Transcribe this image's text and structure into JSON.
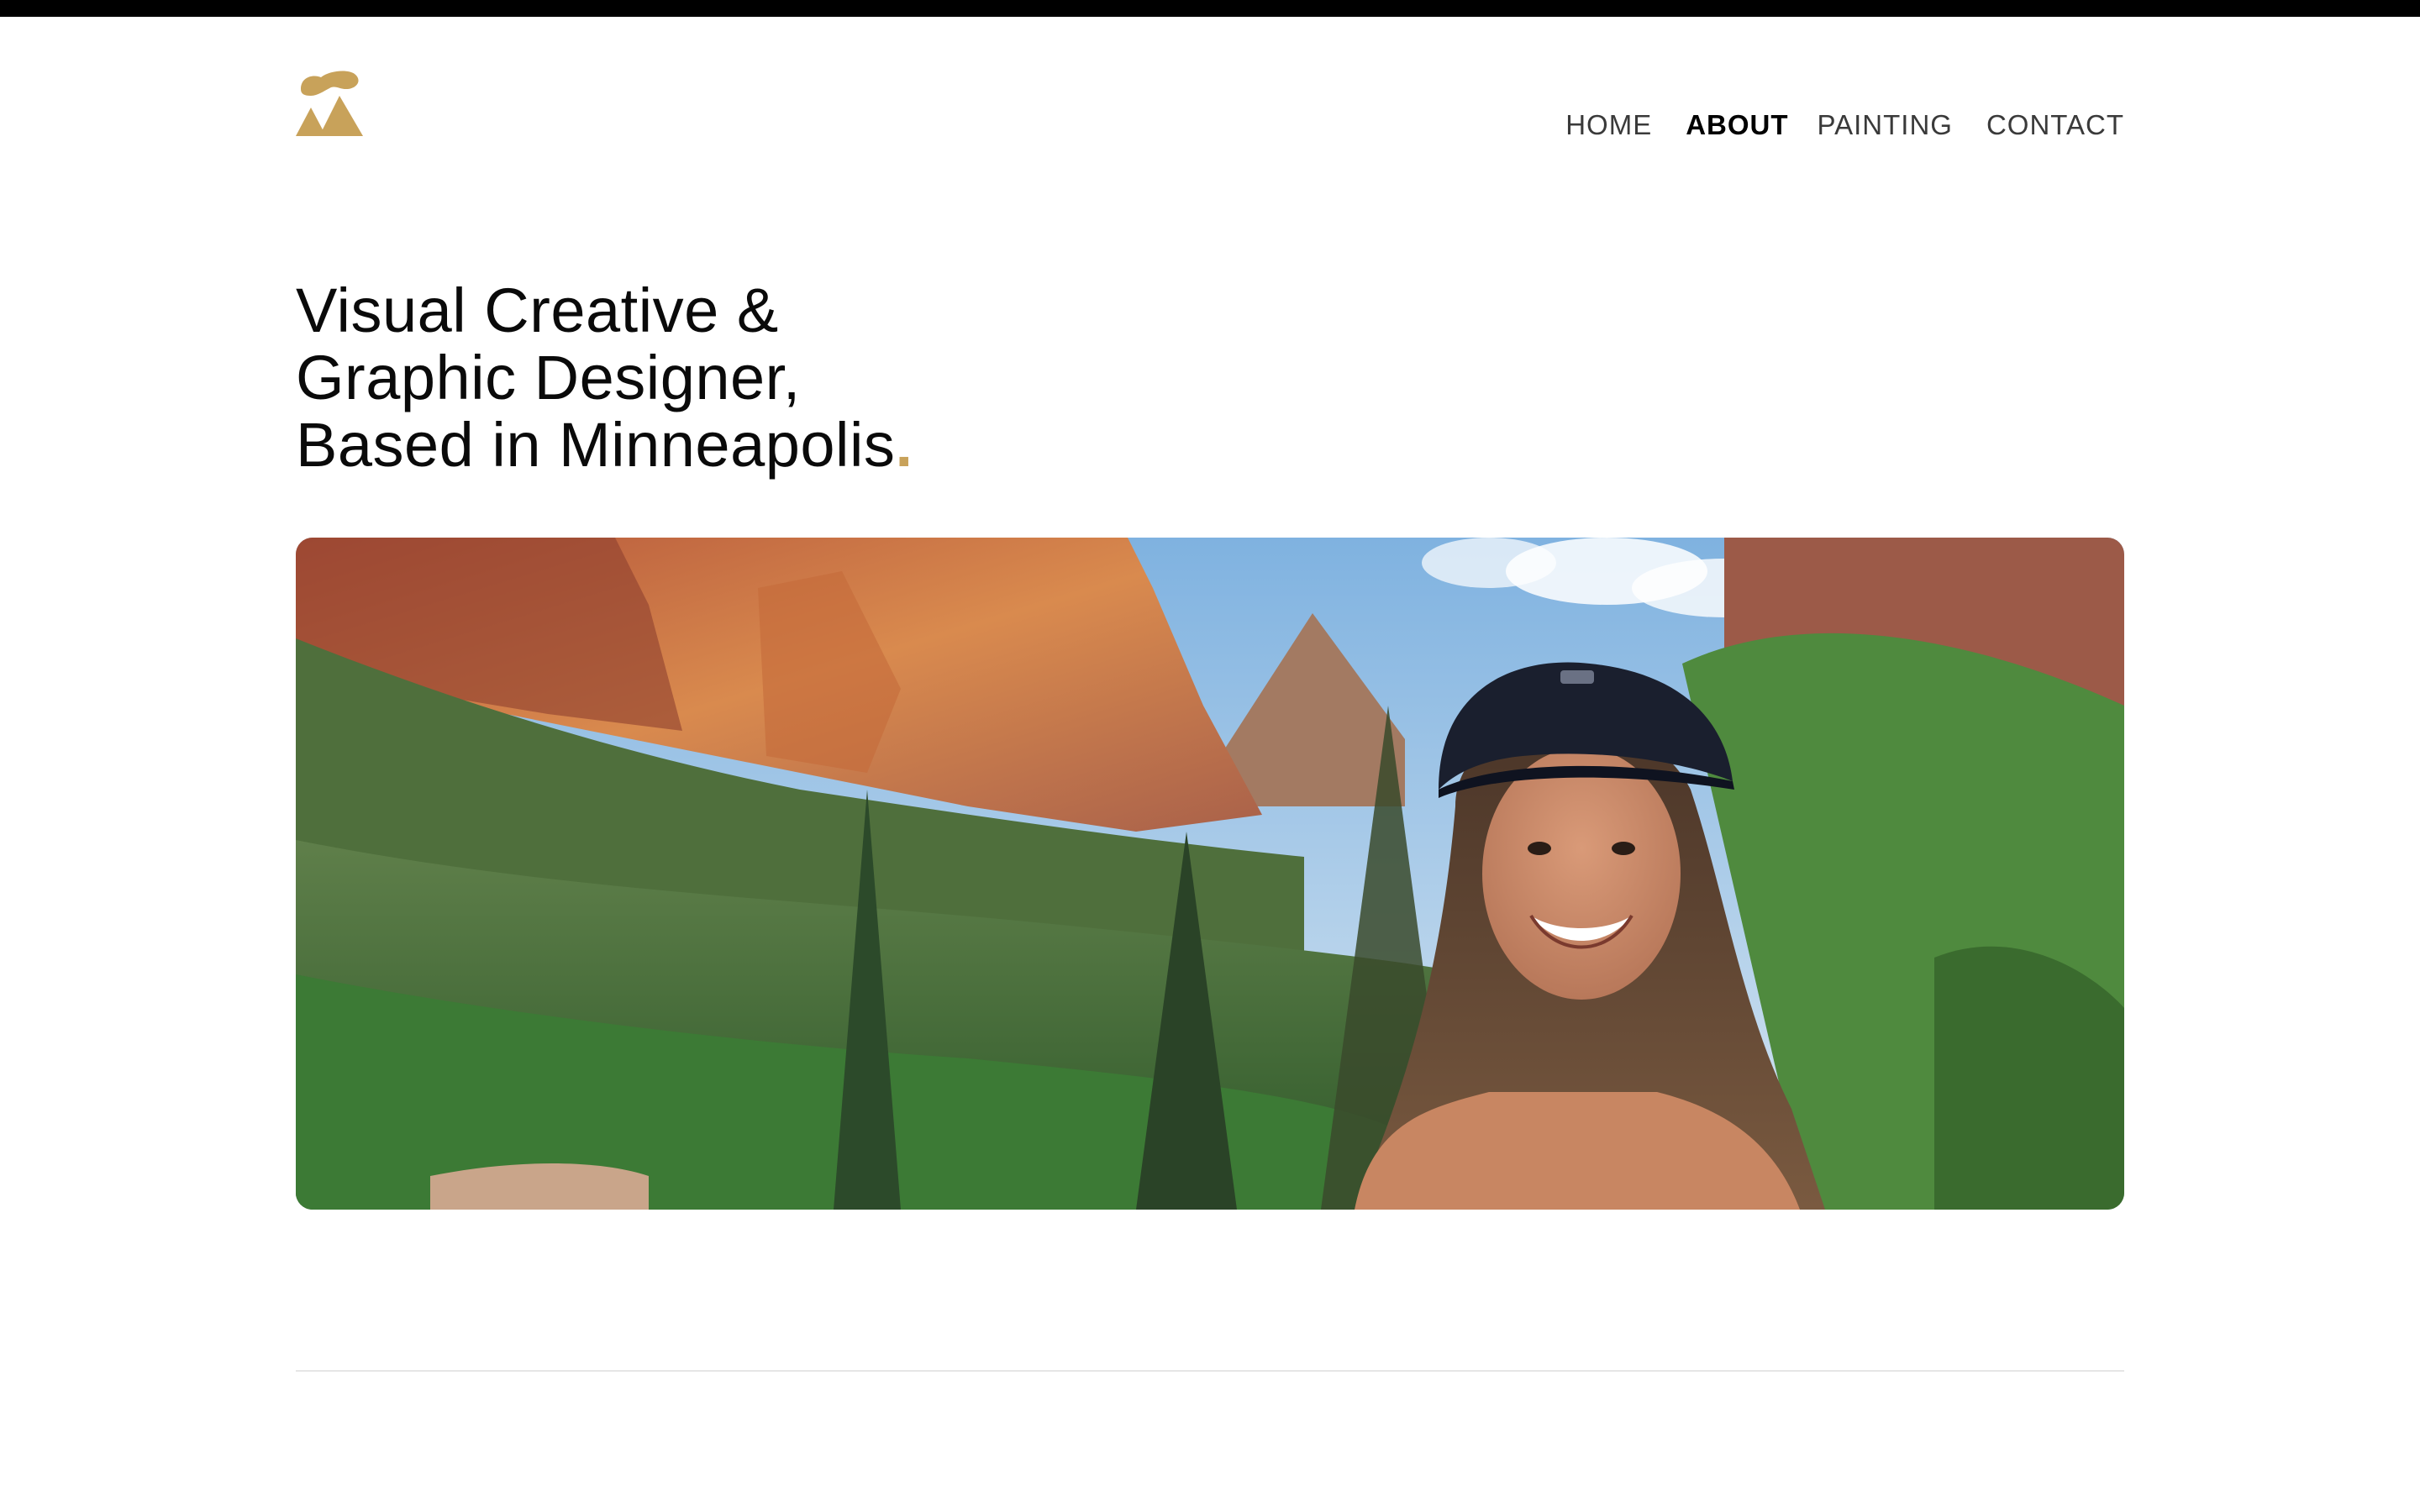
{
  "brand": {
    "logo_icon": "abstract-mountain-mushroom-logo",
    "accent_color": "#c8a25a"
  },
  "nav": {
    "items": [
      {
        "label": "HOME",
        "active": false
      },
      {
        "label": "ABOUT",
        "active": true
      },
      {
        "label": "PAINTING",
        "active": false
      },
      {
        "label": "CONTACT",
        "active": false
      }
    ]
  },
  "hero": {
    "headline_lines": [
      "Visual Creative &",
      "Graphic Designer,",
      "Based in Minneapolis"
    ],
    "headline_dot": ".",
    "image_description_icon": "portrait-photo-canyon-landscape"
  }
}
